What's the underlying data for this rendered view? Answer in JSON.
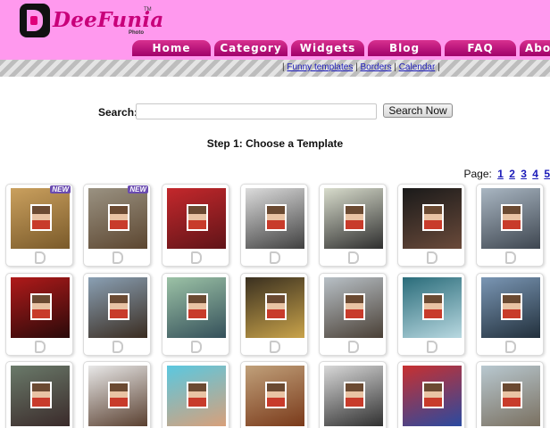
{
  "header": {
    "logo_text": "DeeFunia",
    "logo_tm": "TM",
    "logo_sub": "Photo",
    "accent": "#ff99ee",
    "brand": "#c8007a"
  },
  "nav": {
    "items": [
      {
        "label": "Home"
      },
      {
        "label": "Category"
      },
      {
        "label": "Widgets"
      },
      {
        "label": "Blog"
      },
      {
        "label": "FAQ"
      },
      {
        "label": "Abo"
      }
    ]
  },
  "sublinks": {
    "sep": "|",
    "items": [
      {
        "label": "Funny templates"
      },
      {
        "label": "Borders"
      },
      {
        "label": "Calendar"
      }
    ]
  },
  "search": {
    "label": "Search:",
    "value": "",
    "button_label": "Search Now"
  },
  "step_title": "Step 1: Choose a Template",
  "pager": {
    "label": "Page:",
    "pages": [
      "1",
      "2",
      "3",
      "4",
      "5"
    ]
  },
  "badge_new": "NEW",
  "templates": [
    {
      "name": "lion-holding-photo",
      "new": true,
      "colors": [
        "#caa05e",
        "#7a5a2a"
      ]
    },
    {
      "name": "bear-with-photo",
      "new": true,
      "colors": [
        "#9a9282",
        "#5c4630"
      ]
    },
    {
      "name": "red-dome-photo",
      "new": false,
      "colors": [
        "#c4282c",
        "#601418"
      ]
    },
    {
      "name": "photo-frame-in-room",
      "new": false,
      "colors": [
        "#dcdcdc",
        "#404040"
      ]
    },
    {
      "name": "panda-holding-photo",
      "new": false,
      "colors": [
        "#d8dccc",
        "#2e2e2e"
      ]
    },
    {
      "name": "billboard-night",
      "new": false,
      "colors": [
        "#1a1a1a",
        "#6a4a3a"
      ]
    },
    {
      "name": "city-billboard",
      "new": false,
      "colors": [
        "#a9b6c2",
        "#3e4650"
      ]
    },
    {
      "name": "we-miss-you-michael",
      "new": false,
      "colors": [
        "#b01a1a",
        "#2a0a0a"
      ]
    },
    {
      "name": "street-scene-frame",
      "new": false,
      "colors": [
        "#8aa0b4",
        "#3a2c20"
      ]
    },
    {
      "name": "bus-stop-ad",
      "new": false,
      "colors": [
        "#9cc2a6",
        "#34505a"
      ]
    },
    {
      "name": "building-poster",
      "new": false,
      "colors": [
        "#3a3020",
        "#c9a34a"
      ]
    },
    {
      "name": "street-billboard",
      "new": false,
      "colors": [
        "#b8c0c6",
        "#4a4036"
      ]
    },
    {
      "name": "tower-ad",
      "new": false,
      "colors": [
        "#2a6c7a",
        "#b8d8e0"
      ]
    },
    {
      "name": "bus-shelter-ad",
      "new": false,
      "colors": [
        "#7a96b4",
        "#22303c"
      ]
    },
    {
      "name": "fans-with-photo",
      "new": false,
      "colors": [
        "#6a7a6a",
        "#3a2a2a"
      ]
    },
    {
      "name": "man-holding-photo",
      "new": false,
      "colors": [
        "#e8e8e8",
        "#5a4030"
      ]
    },
    {
      "name": "girl-holding-frame",
      "new": false,
      "colors": [
        "#5ac8e0",
        "#d8a07a"
      ]
    },
    {
      "name": "street-mural-bike",
      "new": false,
      "colors": [
        "#c0a07a",
        "#7a3a1a"
      ]
    },
    {
      "name": "marilyn-bw",
      "new": false,
      "colors": [
        "#d8d8d8",
        "#303030"
      ]
    },
    {
      "name": "magazine-collage",
      "new": false,
      "colors": [
        "#c83030",
        "#2a4aa0"
      ]
    },
    {
      "name": "palace-square",
      "new": false,
      "colors": [
        "#b8c8d0",
        "#7a7060"
      ]
    }
  ]
}
